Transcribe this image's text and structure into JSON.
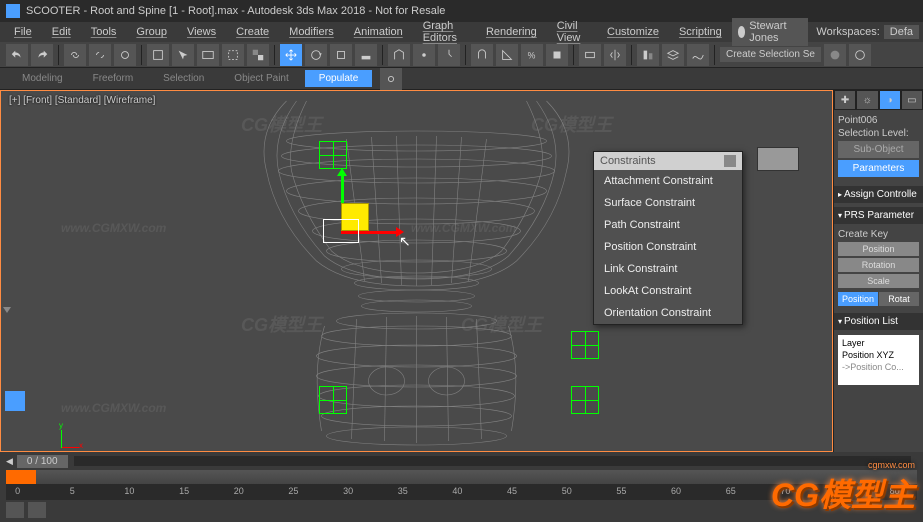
{
  "title": "SCOOTER - Root and Spine [1 - Root].max - Autodesk 3ds Max 2018 - Not for Resale",
  "menu": {
    "items": [
      "File",
      "Edit",
      "Tools",
      "Group",
      "Views",
      "Create",
      "Modifiers",
      "Animation",
      "Graph Editors",
      "Rendering",
      "Civil View",
      "Customize",
      "Scripting"
    ],
    "user": "Stewart Jones",
    "workspaces_label": "Workspaces:",
    "workspaces_value": "Defa"
  },
  "toolbar": {
    "create_dropdown": "Create Selection Se"
  },
  "ribbon": {
    "tabs": [
      "Modeling",
      "Freeform",
      "Selection",
      "Object Paint",
      "Populate"
    ]
  },
  "viewport": {
    "label": "[+] [Front] [Standard] [Wireframe]"
  },
  "popup": {
    "title": "Constraints",
    "items": [
      "Attachment Constraint",
      "Surface Constraint",
      "Path Constraint",
      "Position Constraint",
      "Link Constraint",
      "LookAt Constraint",
      "Orientation Constraint"
    ]
  },
  "command_panel": {
    "object_name": "Point006",
    "selection_level_label": "Selection Level:",
    "sub_object": "Sub-Object",
    "parameters": "Parameters",
    "assign_controller": "Assign Controlle",
    "prs": "PRS Parameter",
    "create_key": "Create Key",
    "pos_btn": "Position",
    "rot_btn": "Rotation",
    "scale_btn": "Scale",
    "tab_pos": "Position",
    "tab_rot": "Rotat",
    "position_list": "Position List",
    "list": {
      "layer": "Layer",
      "xyz": "Position XYZ",
      "posco": "->Position Co..."
    }
  },
  "timeline": {
    "frame_display": "0 / 100",
    "ticks": [
      "0",
      "5",
      "10",
      "15",
      "20",
      "25",
      "30",
      "35",
      "40",
      "45",
      "50",
      "55",
      "60",
      "65",
      "70",
      "75",
      "80"
    ]
  },
  "watermark": {
    "url": "www.CGMXW.com",
    "brand": "CG模型王"
  },
  "logo": {
    "url": "cgmxw.com",
    "brand": "CG模型主"
  }
}
